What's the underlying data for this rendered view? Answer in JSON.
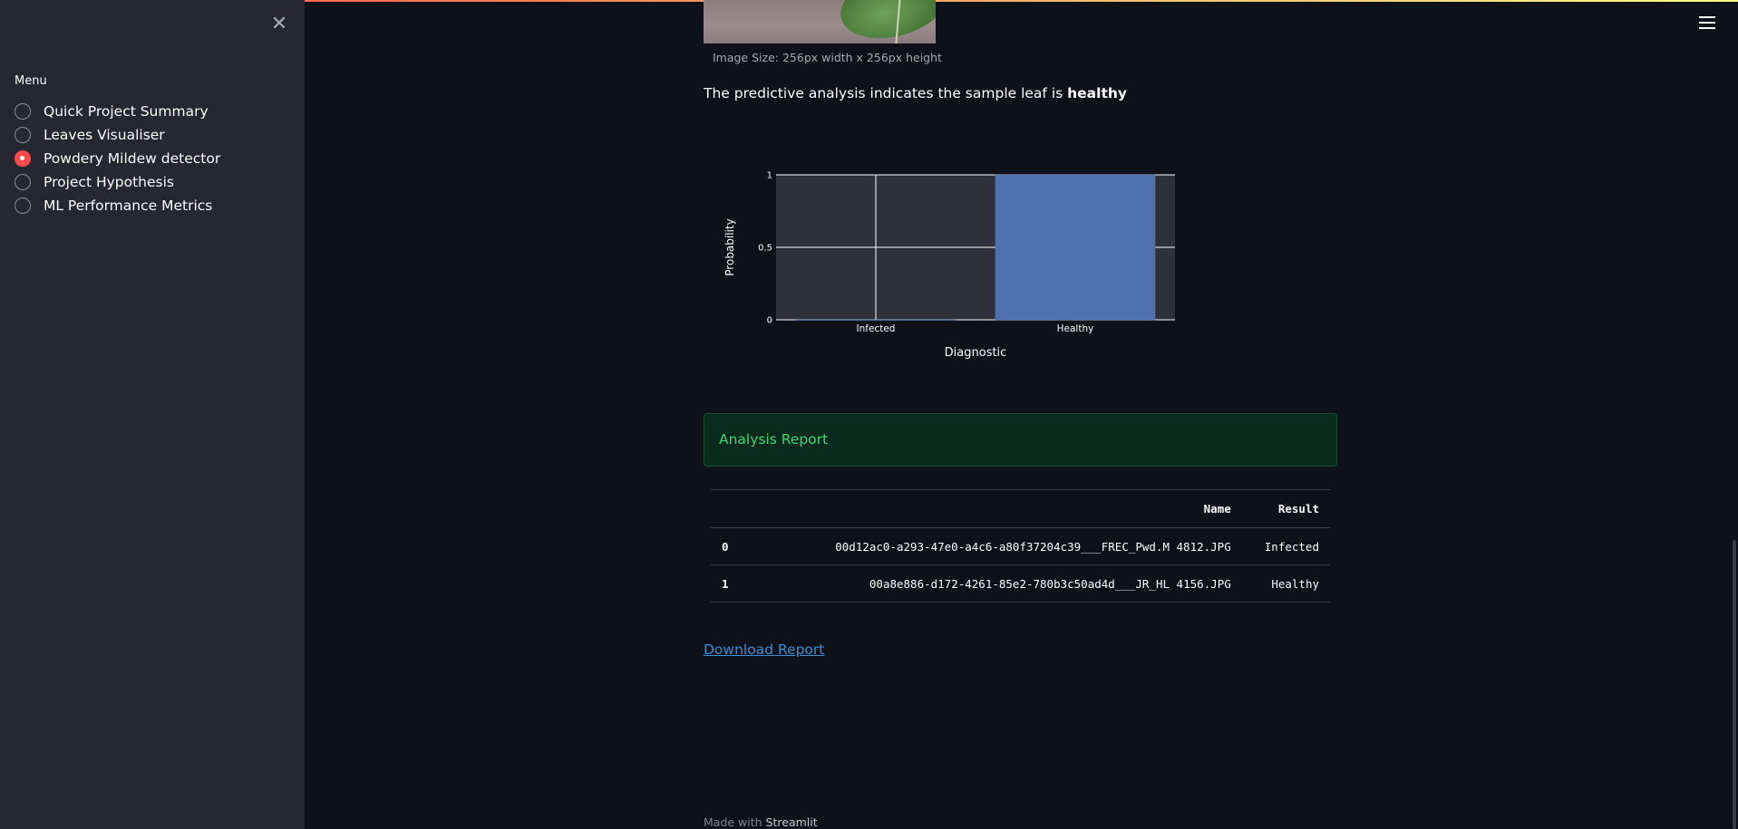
{
  "sidebar": {
    "close_icon": "close-icon",
    "menu_label": "Menu",
    "items": [
      {
        "label": "Quick Project Summary",
        "selected": false
      },
      {
        "label": "Leaves Visualiser",
        "selected": false
      },
      {
        "label": "Powdery Mildew detector",
        "selected": true
      },
      {
        "label": "Project Hypothesis",
        "selected": false
      },
      {
        "label": "ML Performance Metrics",
        "selected": false
      }
    ]
  },
  "header": {
    "menu_icon": "hamburger-icon"
  },
  "main": {
    "image_caption": "Image Size: 256px width x 256px height",
    "prediction_text": "The predictive analysis indicates the sample leaf is ",
    "prediction_result": "healthy",
    "alert_text": "Analysis Report",
    "table": {
      "columns": [
        "",
        "Name",
        "Result"
      ],
      "rows": [
        [
          "0",
          "00d12ac0-a293-47e0-a4c6-a80f37204c39___FREC_Pwd.M 4812.JPG",
          "Infected"
        ],
        [
          "1",
          "00a8e886-d172-4261-85e2-780b3c50ad4d___JR_HL 4156.JPG",
          "Healthy"
        ]
      ]
    },
    "download_label": "Download Report",
    "footer_prefix": "Made with ",
    "footer_brand": "Streamlit"
  },
  "colors": {
    "accent": "#ff4b4b",
    "bar": "#4c72b0",
    "success_text": "#3dd56d",
    "link": "#3b8ed8"
  },
  "chart_data": {
    "type": "bar",
    "categories": [
      "Infected",
      "Healthy"
    ],
    "values": [
      0.0,
      1.0
    ],
    "xlabel": "Diagnostic",
    "ylabel": "Probability",
    "ylim": [
      0,
      1
    ],
    "yticks": [
      0,
      0.5,
      1
    ],
    "ytick_labels": [
      "0",
      "0.5",
      "1"
    ],
    "grid": true
  }
}
